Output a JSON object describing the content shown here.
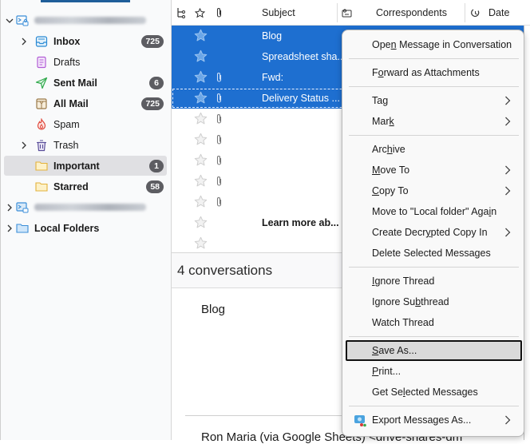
{
  "sidebar": {
    "account1": {
      "label": "[blurred account email]"
    },
    "folders": [
      {
        "name": "Inbox",
        "bold": true,
        "badge": "725",
        "icon": "inbox-icon",
        "expandable": true
      },
      {
        "name": "Drafts",
        "bold": false,
        "badge": "",
        "icon": "drafts-icon",
        "expandable": false
      },
      {
        "name": "Sent Mail",
        "bold": true,
        "badge": "6",
        "icon": "sent-icon",
        "expandable": false
      },
      {
        "name": "All Mail",
        "bold": true,
        "badge": "725",
        "icon": "all-mail-icon",
        "expandable": false
      },
      {
        "name": "Spam",
        "bold": false,
        "badge": "",
        "icon": "spam-icon",
        "expandable": false
      },
      {
        "name": "Trash",
        "bold": false,
        "badge": "",
        "icon": "trash-icon",
        "expandable": true
      },
      {
        "name": "Important",
        "bold": true,
        "badge": "1",
        "icon": "folder-icon",
        "expandable": false,
        "selected": true
      },
      {
        "name": "Starred",
        "bold": true,
        "badge": "58",
        "icon": "folder-icon",
        "expandable": false
      }
    ],
    "account2": {
      "label": "[blurred account email]"
    },
    "local_folders": {
      "label": "Local Folders"
    }
  },
  "message_list": {
    "columns": {
      "subject": "Subject",
      "correspondents": "Correspondents",
      "date": "Date"
    },
    "rows": [
      {
        "subject": "Blog",
        "selected": true,
        "starred": false,
        "attachment": false,
        "bold": false
      },
      {
        "subject": "Spreadsheet sha...",
        "selected": true,
        "starred": false,
        "attachment": false,
        "bold": false
      },
      {
        "subject": "Fwd:",
        "selected": true,
        "starred": false,
        "attachment": true,
        "bold": false
      },
      {
        "subject": "Delivery Status ...",
        "selected": true,
        "starred": false,
        "attachment": true,
        "bold": false,
        "focused": true
      },
      {
        "subject": "",
        "selected": false,
        "attachment": true
      },
      {
        "subject": "",
        "selected": false,
        "attachment": true
      },
      {
        "subject": "",
        "selected": false,
        "attachment": true
      },
      {
        "subject": "",
        "selected": false,
        "attachment": true
      },
      {
        "subject": "",
        "selected": false,
        "attachment": true
      },
      {
        "subject": "Learn more ab...",
        "selected": false,
        "attachment": false,
        "bold": true
      },
      {
        "subject": "",
        "selected": false,
        "attachment": false
      }
    ]
  },
  "preview": {
    "header": "4 conversations",
    "first_subject": "Blog",
    "sender_line": "Ron Maria (via Google Sheets) <drive-shares-dm"
  },
  "context_menu": {
    "items": [
      {
        "pre": "Ope",
        "u": "n",
        "post": " Message in Conversation",
        "submenu": false
      },
      {
        "sep": true
      },
      {
        "pre": "F",
        "u": "o",
        "post": "rward as Attachments",
        "submenu": false
      },
      {
        "sep": true
      },
      {
        "pre": "Tag",
        "u": "",
        "post": "",
        "submenu": true
      },
      {
        "pre": "Mar",
        "u": "k",
        "post": "",
        "submenu": true
      },
      {
        "sep": true
      },
      {
        "pre": "Arc",
        "u": "h",
        "post": "ive",
        "submenu": false
      },
      {
        "pre": "",
        "u": "M",
        "post": "ove To",
        "submenu": true
      },
      {
        "pre": "",
        "u": "C",
        "post": "opy To",
        "submenu": true
      },
      {
        "pre": "Move to \"Local folder\" Aga",
        "u": "i",
        "post": "n",
        "submenu": false
      },
      {
        "pre": "Create Decr",
        "u": "y",
        "post": "pted Copy In",
        "submenu": true
      },
      {
        "pre": "Delete Selected Messages",
        "u": "",
        "post": "",
        "submenu": false
      },
      {
        "sep": true
      },
      {
        "pre": "",
        "u": "I",
        "post": "gnore Thread",
        "submenu": false
      },
      {
        "pre": "Ignore Su",
        "u": "b",
        "post": "thread",
        "submenu": false
      },
      {
        "pre": "Watch Thread",
        "u": "",
        "post": "",
        "submenu": false
      },
      {
        "sep": true
      },
      {
        "pre": "",
        "u": "S",
        "post": "ave As...",
        "submenu": false,
        "hover": true
      },
      {
        "pre": "",
        "u": "P",
        "post": "rint...",
        "submenu": false
      },
      {
        "pre": "Get Se",
        "u": "l",
        "post": "ected Messages",
        "submenu": false
      },
      {
        "sep": true
      },
      {
        "pre": "Export Messages As...",
        "u": "",
        "post": "",
        "submenu": true,
        "icon": "export-icon"
      }
    ]
  },
  "colors": {
    "selection": "#1e6fd0",
    "badge": "#5d5d62",
    "menu_bg": "#f9f9f9"
  }
}
